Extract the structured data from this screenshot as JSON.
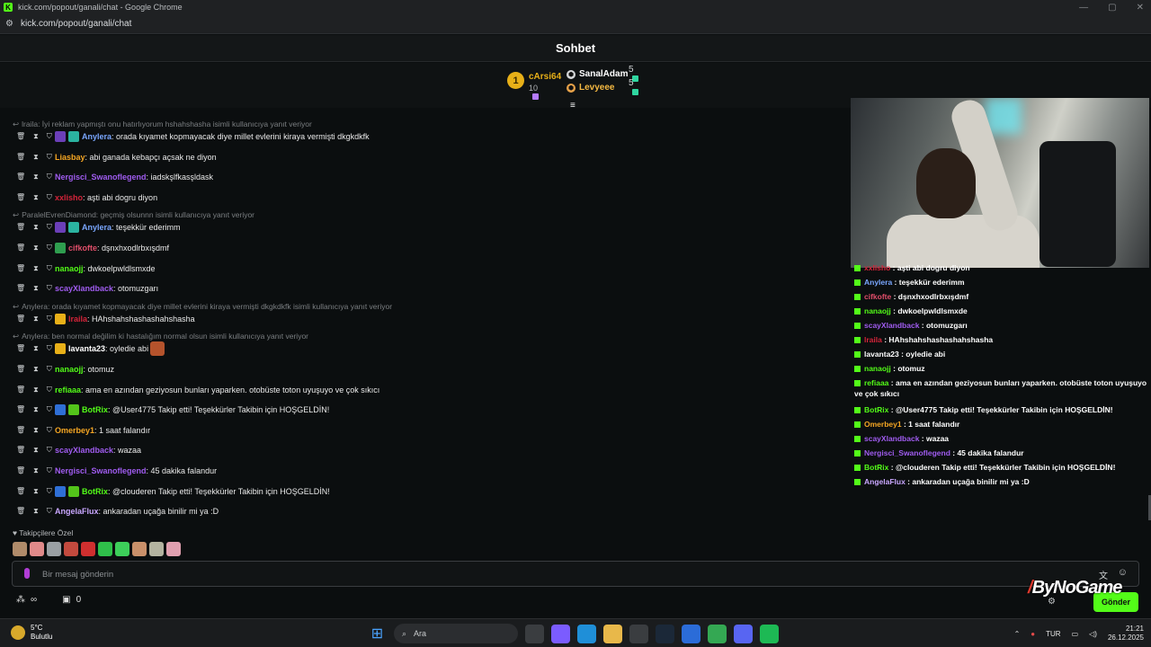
{
  "window": {
    "title": "kick.com/popout/ganali/chat - Google Chrome",
    "url": "kick.com/popout/ganali/chat",
    "controls": [
      "—",
      "▢",
      "✕"
    ]
  },
  "header": {
    "title": "Sohbet"
  },
  "leaderboard": {
    "first": {
      "rank": "1",
      "name": "cArsi64",
      "count": "10"
    },
    "rows": [
      {
        "name": "SanalAdam",
        "count": "5",
        "color": "#ffffff",
        "icon_color": "#d6d8da"
      },
      {
        "name": "Levyeee",
        "count": "5",
        "color": "#f5b942",
        "icon_color": "#e8a34a"
      }
    ],
    "toggle_icon": "chevron-list-icon"
  },
  "messages": [
    {
      "type": "reply",
      "text": "lraila: İyi reklam yapmıştı onu hatırlıyorum hshahshasha isimli kullanıcıya yanıt veriyor"
    },
    {
      "type": "msg",
      "user": "Anylera",
      "color": "#7aa7ff",
      "badges": [
        "#6b3fb8",
        "#2bb3a0"
      ],
      "text": ": orada kıyamet kopmayacak diye millet evlerini kiraya vermişti dkgkdkfk"
    },
    {
      "type": "msg",
      "user": "Liasbay",
      "color": "#f5a623",
      "badges": [],
      "text": ": abi ganada kebapçı açsak ne diyon"
    },
    {
      "type": "msg",
      "user": "Nergisci_Swanoflegend",
      "color": "#a05cf0",
      "badges": [],
      "text": ": iadskşlfkasşldask"
    },
    {
      "type": "msg",
      "user": "xxlisho",
      "color": "#d6243a",
      "badges": [],
      "text": ": aşti abi dogru diyon"
    },
    {
      "type": "reply",
      "text": "ParalelEvrenDiamond: geçmiş olsunnn isimli kullanıcıya yanıt veriyor"
    },
    {
      "type": "msg",
      "user": "Anylera",
      "color": "#7aa7ff",
      "badges": [
        "#6b3fb8",
        "#2bb3a0"
      ],
      "text": ": teşekkür ederimm"
    },
    {
      "type": "msg",
      "user": "cifkofte",
      "color": "#e04e6a",
      "badges": [
        "#2f9e4f"
      ],
      "text": ": dşnxhxodlrbxışdmf"
    },
    {
      "type": "msg",
      "user": "nanaojj",
      "color": "#53fc18",
      "badges": [],
      "text": ": dwkoelpwldlsmxde"
    },
    {
      "type": "msg",
      "user": "scayXlandback",
      "color": "#a05cf0",
      "badges": [],
      "text": ": otomuzgarı"
    },
    {
      "type": "reply",
      "text": "Anylera: orada kıyamet kopmayacak diye millet evlerini kiraya vermişti dkgkdkfk isimli kullanıcıya yanıt veriyor"
    },
    {
      "type": "msg",
      "user": "lraila",
      "color": "#d6243a",
      "badges": [
        "#e8b018"
      ],
      "text": ": HAhshahshashashahshasha"
    },
    {
      "type": "reply",
      "text": "Anylera: ben normal değilim ki hastalığım normal olsun   isimli kullanıcıya yanıt veriyor"
    },
    {
      "type": "msg",
      "user": "lavanta23",
      "color": "#ffffff",
      "badges": [
        "#e8b018"
      ],
      "text": ":  oyledie abi"
    },
    {
      "type": "msg",
      "user": "nanaojj",
      "color": "#53fc18",
      "badges": [],
      "text": ": otomuz"
    },
    {
      "type": "msg",
      "user": "refiaaa",
      "color": "#53fc18",
      "badges": [],
      "text": ": ama en azından geziyosun bunları yaparken. otobüste toton uyuşuyo ve çok sıkıcı"
    },
    {
      "type": "msg",
      "user": "BotRix",
      "color": "#53fc18",
      "badges": [
        "#2f6fd6",
        "#53c41a"
      ],
      "text": ": @User4775 Takip etti! Teşekkürler Takibin için HOŞGELDİN!"
    },
    {
      "type": "msg",
      "user": "Omerbey1",
      "color": "#f5a623",
      "badges": [],
      "text": ": 1 saat falandır"
    },
    {
      "type": "msg",
      "user": "scayXlandback",
      "color": "#a05cf0",
      "badges": [],
      "text": ": wazaa"
    },
    {
      "type": "msg",
      "user": "Nergisci_Swanoflegend",
      "color": "#a05cf0",
      "badges": [],
      "text": ": 45 dakika falandur"
    },
    {
      "type": "msg",
      "user": "BotRix",
      "color": "#53fc18",
      "badges": [
        "#2f6fd6",
        "#53c41a"
      ],
      "text": ": @clouderen Takip etti! Teşekkürler Takibin için HOŞGELDİN!"
    },
    {
      "type": "msg",
      "user": "AngelaFlux",
      "color": "#c9a7ff",
      "badges": [],
      "text": ": ankaradan uçağa binilir mi ya :D"
    }
  ],
  "follower_emotes": {
    "label": "Takipçilere Özel",
    "colors": [
      "#b08b6a",
      "#e08a8a",
      "#9aa0a4",
      "#c24a3e",
      "#cf2f2f",
      "#2fbf4a",
      "#3dcf5a",
      "#c9906a",
      "#b3b3a0",
      "#e0a0b0"
    ]
  },
  "input": {
    "placeholder": "Bir mesaj gönderin",
    "translate_icon": "translate-icon",
    "emoji_icon": "emoji-icon"
  },
  "bottom": {
    "infinity": "∞",
    "points": "0",
    "send_label": "Gönder"
  },
  "overlay_chat": [
    {
      "user": "xxlisho",
      "color": "#d6243a",
      "text": " : aşti abi dogru diyon"
    },
    {
      "user": "Anylera",
      "color": "#7aa7ff",
      "text": " : teşekkür ederimm"
    },
    {
      "user": "cifkofte",
      "color": "#e04e6a",
      "text": " : dşnxhxodlrbxışdmf"
    },
    {
      "user": "nanaojj",
      "color": "#53fc18",
      "text": " : dwkoelpwldlsmxde"
    },
    {
      "user": "scayXlandback",
      "color": "#a05cf0",
      "text": " : otomuzgarı"
    },
    {
      "user": "lraila",
      "color": "#d6243a",
      "text": " : HAhshahshashashahshasha"
    },
    {
      "user": "lavanta23",
      "color": "#ffffff",
      "text": " :  oyledie abi"
    },
    {
      "user": "nanaojj",
      "color": "#53fc18",
      "text": " : otomuz"
    },
    {
      "user": "refiaaa",
      "color": "#53fc18",
      "text": " : ama en azından geziyosun bunları yaparken. otobüste toton uyuşuyo ve çok sıkıcı"
    },
    {
      "user": "BotRix",
      "color": "#53fc18",
      "text": " : @User4775 Takip etti! Teşekkürler Takibin için HOŞGELDİN!"
    },
    {
      "user": "Omerbey1",
      "color": "#f5a623",
      "text": " : 1 saat falandır"
    },
    {
      "user": "scayXlandback",
      "color": "#a05cf0",
      "text": " : wazaa"
    },
    {
      "user": "Nergisci_Swanoflegend",
      "color": "#a05cf0",
      "text": " : 45 dakika falandur"
    },
    {
      "user": "BotRix",
      "color": "#53fc18",
      "text": " : @clouderen Takip etti! Teşekkürler Takibin için HOŞGELDİN!"
    },
    {
      "user": "AngelaFlux",
      "color": "#c9a7ff",
      "text": " : ankaradan uçağa binilir mi ya :D"
    }
  ],
  "watermark": "ByNoGame",
  "taskbar": {
    "weather": {
      "temp": "5°C",
      "desc": "Bulutlu"
    },
    "search_placeholder": "Ara",
    "apps": [
      {
        "name": "task-view-icon",
        "color": "#3a3d40"
      },
      {
        "name": "copilot-icon",
        "color": "#7b5cff"
      },
      {
        "name": "edge-icon",
        "color": "#1f8fd8"
      },
      {
        "name": "file-explorer-icon",
        "color": "#e8b84a"
      },
      {
        "name": "store-icon",
        "color": "#3a3d40"
      },
      {
        "name": "steam-icon",
        "color": "#1b2838"
      },
      {
        "name": "mail-icon",
        "color": "#2b6cd8"
      },
      {
        "name": "chrome-icon",
        "color": "#34a853"
      },
      {
        "name": "discord-icon",
        "color": "#5865f2"
      },
      {
        "name": "spotify-icon",
        "color": "#1db954"
      }
    ],
    "lang": "TUR",
    "time": "21:21",
    "date": "26.12.2025"
  }
}
